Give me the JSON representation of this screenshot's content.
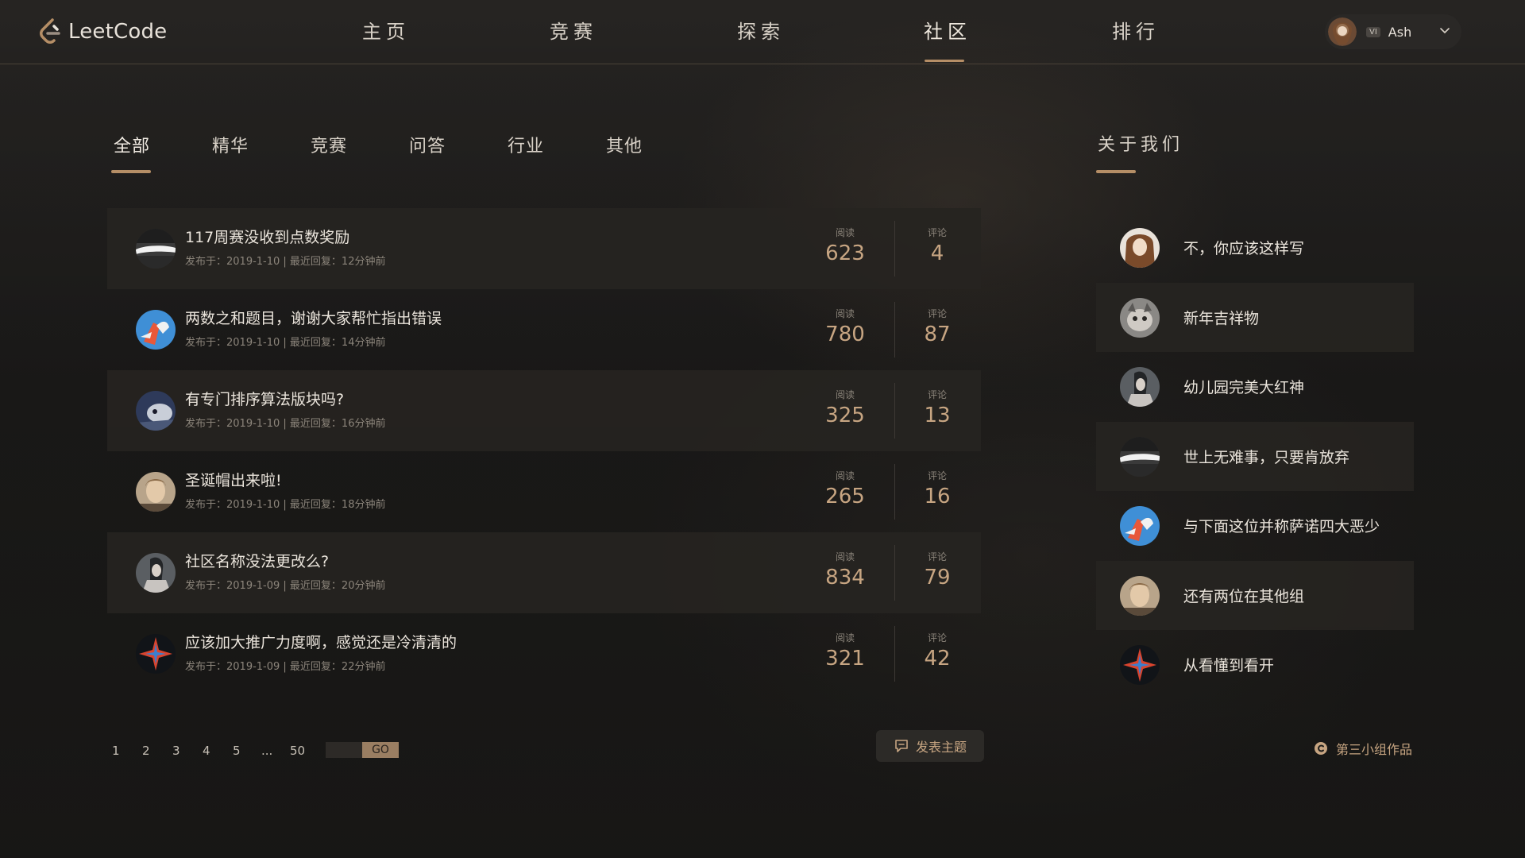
{
  "brand": {
    "name": "LeetCode"
  },
  "nav": {
    "items": [
      {
        "label": "主页"
      },
      {
        "label": "竞赛"
      },
      {
        "label": "探索"
      },
      {
        "label": "社区"
      },
      {
        "label": "排行"
      }
    ],
    "active": "社区"
  },
  "user": {
    "badge": "VI",
    "name": "Ash"
  },
  "tabs": {
    "items": [
      {
        "label": "全部"
      },
      {
        "label": "精华"
      },
      {
        "label": "竞赛"
      },
      {
        "label": "问答"
      },
      {
        "label": "行业"
      },
      {
        "label": "其他"
      }
    ],
    "active": "全部"
  },
  "topics": {
    "read_label": "阅读",
    "comment_label": "评论",
    "items": [
      {
        "title": "117周赛没收到点数奖励",
        "meta": "发布于：2019-1-10 | 最近回复：12分钟前",
        "reads": "623",
        "comments": "4"
      },
      {
        "title": "两数之和题目，谢谢大家帮忙指出错误",
        "meta": "发布于：2019-1-10 | 最近回复：14分钟前",
        "reads": "780",
        "comments": "87"
      },
      {
        "title": "有专门排序算法版块吗?",
        "meta": "发布于：2019-1-10 | 最近回复：16分钟前",
        "reads": "325",
        "comments": "13"
      },
      {
        "title": "圣诞帽出来啦!",
        "meta": "发布于：2019-1-10 | 最近回复：18分钟前",
        "reads": "265",
        "comments": "16"
      },
      {
        "title": "社区名称没法更改么?",
        "meta": "发布于：2019-1-09 | 最近回复：20分钟前",
        "reads": "834",
        "comments": "79"
      },
      {
        "title": "应该加大推广力度啊，感觉还是冷清清的",
        "meta": "发布于：2019-1-09 | 最近回复：22分钟前",
        "reads": "321",
        "comments": "42"
      }
    ]
  },
  "pagination": {
    "pages": [
      "1",
      "2",
      "3",
      "4",
      "5",
      "...",
      "50"
    ],
    "go_label": "GO"
  },
  "post_button": {
    "label": "发表主题"
  },
  "about": {
    "title": "关于我们",
    "members": [
      {
        "name": "不，你应该这样写"
      },
      {
        "name": "新年吉祥物"
      },
      {
        "name": "幼儿园完美大红神"
      },
      {
        "name": "世上无难事，只要肯放弃"
      },
      {
        "name": "与下面这位并称萨诺四大恶少"
      },
      {
        "name": "还有两位在其他组"
      },
      {
        "name": "从看懂到看开"
      }
    ],
    "credit": "第三小组作品"
  },
  "colors": {
    "accent": "#b58e66",
    "number": "#c7a582",
    "background": "#1b1a19"
  }
}
